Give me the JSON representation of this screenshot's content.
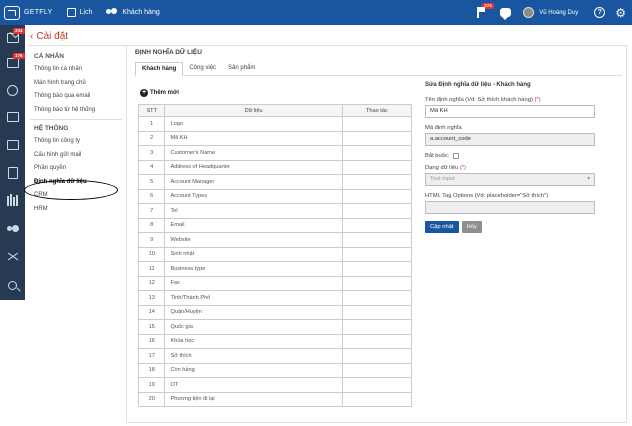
{
  "topbar": {
    "brand": "GETFLY",
    "nav": [
      {
        "label": "Lịch",
        "icon": "calendar-icon"
      },
      {
        "label": "Khách hàng",
        "icon": "customers-icon"
      }
    ],
    "flag_badge": "274",
    "user_name": "Vũ Hoàng Duy",
    "help_label": "?",
    "settings_icon": "gear-icon",
    "color": "#1a56a0"
  },
  "rail": {
    "badges": {
      "mail": "244",
      "calendar": "176"
    },
    "icons": [
      "mail-icon",
      "calendar-icon",
      "workflow-icon",
      "presentation-icon",
      "list-icon",
      "clipboard-icon",
      "books-icon",
      "people-icon",
      "network-icon",
      "search-icon"
    ],
    "color": "#263b52"
  },
  "page": {
    "back_icon": "‹",
    "title": "Cài đặt"
  },
  "settings_nav": {
    "personal_heading": "CÁ NHÂN",
    "personal_items": [
      "Thông tin cá nhân",
      "Màn hình trang chủ",
      "Thông báo qua email",
      "Thông báo từ hệ thống"
    ],
    "system_heading": "HỆ THỐNG",
    "system_items": [
      "Thông tin công ty",
      "Cấu hình gửi mail",
      "Phân quyền",
      "Định nghĩa dữ liệu",
      "CRM",
      "HRM"
    ],
    "active_item": "Định nghĩa dữ liệu"
  },
  "main": {
    "title": "ĐỊNH NGHĨA DỮ LIỆU",
    "tabs": [
      "Khách hàng",
      "Công việc",
      "Sản phẩm"
    ],
    "active_tab": "Khách hàng",
    "add_label": "Thêm mới",
    "table": {
      "headers": [
        "STT",
        "Dữ liệu",
        "Thao tác"
      ],
      "rows": [
        [
          "1",
          "Logo"
        ],
        [
          "2",
          "Mã KH"
        ],
        [
          "3",
          "Customer's Name"
        ],
        [
          "4",
          "Address of Headquarter"
        ],
        [
          "5",
          "Account Manager"
        ],
        [
          "6",
          "Account Types"
        ],
        [
          "7",
          "Tel"
        ],
        [
          "8",
          "Email"
        ],
        [
          "9",
          "Website"
        ],
        [
          "10",
          "Sinh nhật"
        ],
        [
          "11",
          "Business type"
        ],
        [
          "12",
          "Fax"
        ],
        [
          "13",
          "Tỉnh/Thành Phố"
        ],
        [
          "14",
          "Quận/Huyện"
        ],
        [
          "15",
          "Quốc gia"
        ],
        [
          "16",
          "Khóa học"
        ],
        [
          "17",
          "Sở thích"
        ],
        [
          "18",
          "Còn hàng"
        ],
        [
          "19",
          "OT"
        ],
        [
          "20",
          "Phương tiện đi lại"
        ]
      ]
    }
  },
  "edit_panel": {
    "title": "Sửa Định nghĩa dữ liệu - Khách hàng",
    "name_label": "Tên định nghĩa (Vd: Sở thích khách hàng)",
    "required_mark": "(*)",
    "name_value": "Mã KH",
    "code_label": "Mã định nghĩa",
    "code_value": "a.account_code",
    "required_label": "Bắt buộc:",
    "required_checked": false,
    "type_label": "Dạng dữ liệu",
    "type_value": "Text input",
    "html_label": "HTML Tag Options (Vd: placeholder=\"Sở thích\")",
    "html_value": "",
    "save_label": "Cập nhật",
    "cancel_label": "Hủy"
  }
}
